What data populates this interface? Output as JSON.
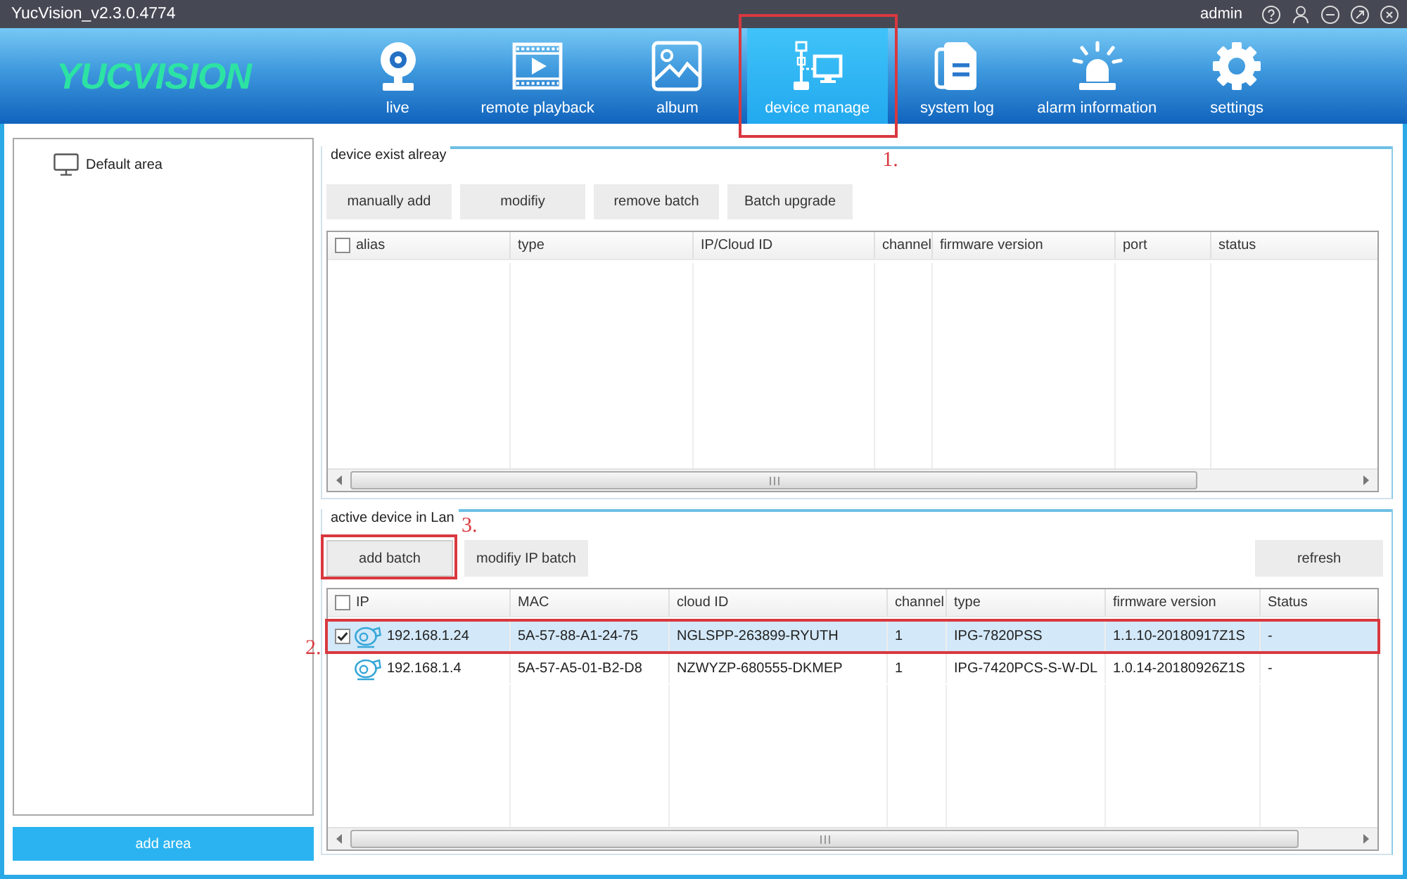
{
  "window": {
    "title": "YucVision_v2.3.0.4774",
    "user": "admin"
  },
  "logo": "YUCVISION",
  "nav": [
    {
      "label": "live",
      "selected": false
    },
    {
      "label": "remote playback",
      "selected": false
    },
    {
      "label": "album",
      "selected": false
    },
    {
      "label": "device manage",
      "selected": true,
      "annotation": "1."
    },
    {
      "label": "system log",
      "selected": false
    },
    {
      "label": "alarm information",
      "selected": false
    },
    {
      "label": "settings",
      "selected": false
    }
  ],
  "sidebar": {
    "items": [
      {
        "label": "Default area"
      }
    ],
    "button": "add area"
  },
  "existing_devices": {
    "title": "device exist alreay",
    "buttons": [
      {
        "label": "manually add"
      },
      {
        "label": "modifiy"
      },
      {
        "label": "remove batch"
      },
      {
        "label": "Batch upgrade"
      }
    ],
    "table": {
      "select_all": false,
      "columns": [
        "alias",
        "type",
        "IP/Cloud ID",
        "channel",
        "firmware version",
        "port",
        "status"
      ]
    }
  },
  "lan_devices": {
    "title": "active device in Lan",
    "buttons": [
      {
        "label": "add batch",
        "annotation": "3."
      },
      {
        "label": "modifiy IP batch"
      }
    ],
    "refresh_button": "refresh",
    "table": {
      "select_all": false,
      "columns": [
        "IP",
        "MAC",
        "cloud ID",
        "channel",
        "type",
        "firmware version",
        "Status"
      ],
      "rows": [
        {
          "selected": true,
          "checked": true,
          "annotation": "2.",
          "cells": [
            "192.168.1.24",
            "5A-57-88-A1-24-75",
            "NGLSPP-263899-RYUTH",
            "1",
            "IPG-7820PSS",
            "1.1.10-20180917Z1S",
            "-"
          ]
        },
        {
          "selected": false,
          "checked": false,
          "cells": [
            "192.168.1.4",
            "5A-57-A5-01-B2-D8",
            "NZWYZP-680555-DKMEP",
            "1",
            "IPG-7420PCS-S-W-DL",
            "1.0.14-20180926Z1S",
            "-"
          ]
        }
      ]
    }
  }
}
